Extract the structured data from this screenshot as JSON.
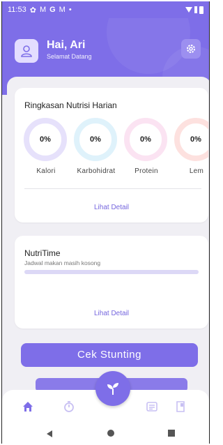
{
  "status_bar": {
    "time": "11:53",
    "icons": [
      "gear-icon",
      "mail-icon",
      "google-icon",
      "mail-icon",
      "dot-icon"
    ],
    "right_icons": [
      "wifi-icon",
      "signal-icon",
      "battery-icon"
    ]
  },
  "header": {
    "greeting": "Hai, Ari",
    "subtitle": "Selamat Datang",
    "avatar_icon": "user-icon",
    "settings_icon": "gear-icon"
  },
  "nutrition_summary": {
    "title": "Ringkasan Nutrisi Harian",
    "rings": [
      {
        "label": "Kalori",
        "value": "0%",
        "color": "#e6e1fb"
      },
      {
        "label": "Karbohidrat",
        "value": "0%",
        "color": "#dff2fb"
      },
      {
        "label": "Protein",
        "value": "0%",
        "color": "#fbe3f2"
      },
      {
        "label": "Lem",
        "value": "0%",
        "color": "#fde1df"
      }
    ],
    "detail_link": "Lihat Detail"
  },
  "nutritime": {
    "title": "NutriTime",
    "subtitle": "Jadwal makan masih kosong",
    "progress": 0,
    "detail_link": "Lihat Detail"
  },
  "actions": {
    "cek_stunting": "Cek Stunting"
  },
  "bottom_nav": {
    "items": [
      "home-icon",
      "timer-icon",
      "leaf-icon",
      "id-card-icon",
      "report-icon"
    ]
  },
  "colors": {
    "primary": "#7e6ee8",
    "link": "#7566de",
    "background": "#f0eff4"
  }
}
